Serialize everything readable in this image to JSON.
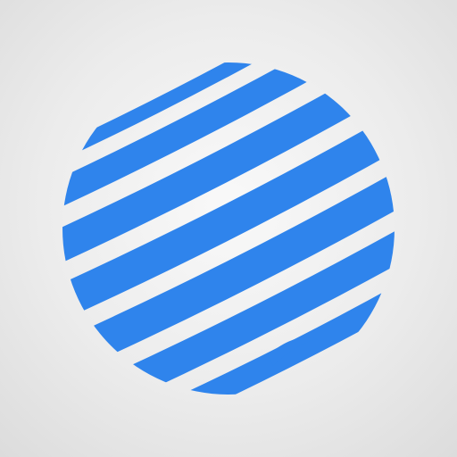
{
  "logo": {
    "name": "striped-globe-icon",
    "colors": {
      "stripe": "#2f84ec",
      "background": "#ececec"
    }
  }
}
